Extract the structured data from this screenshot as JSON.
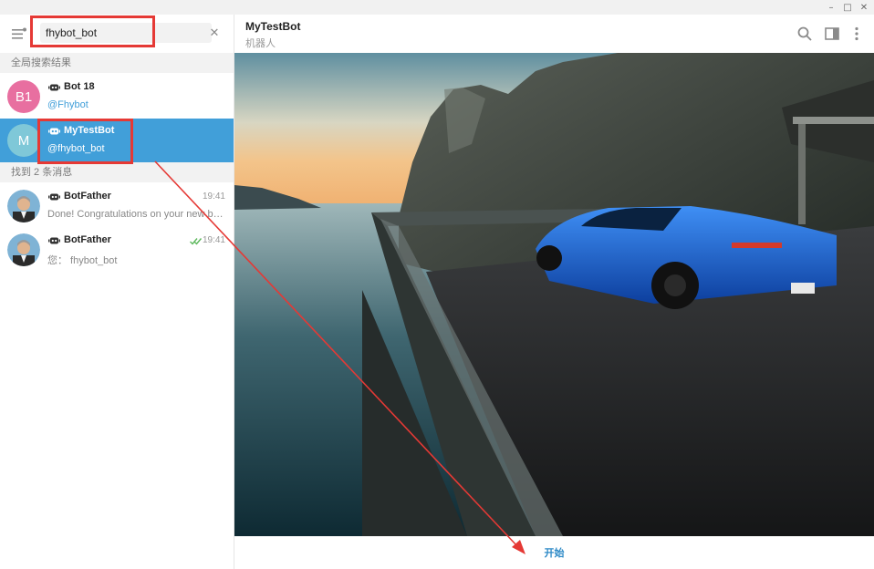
{
  "window": {
    "minimize_glyph": "–",
    "maximize_glyph": "□",
    "close_glyph": "✕"
  },
  "sidebar": {
    "menu_icon": "hamburger-menu-icon",
    "search": {
      "value": "fhybot_bot",
      "clear_glyph": "✕"
    },
    "global_section_label": "全局搜索结果",
    "global_results": [
      {
        "avatar_text": "B1",
        "avatar_color": "#e86fa0",
        "name": "Bot 18",
        "subtitle": "@Fhybot"
      },
      {
        "avatar_text": "M",
        "avatar_color": "#7fc8d8",
        "name": "MyTestBot",
        "subtitle": "@fhybot_bot",
        "selected": true
      }
    ],
    "messages_section_label": "找到 2 条消息",
    "message_results": [
      {
        "name": "BotFather",
        "time": "19:41",
        "snippet": "Done! Congratulations on your new bot. ..."
      },
      {
        "name": "BotFather",
        "time": "19:41",
        "snippet": "您：  fhybot_bot",
        "read": true
      }
    ]
  },
  "chat": {
    "title": "MyTestBot",
    "status": "机器人",
    "icons": [
      "search-icon",
      "sidebar-toggle-icon",
      "more-vertical-icon"
    ],
    "start_label": "开始"
  },
  "colors": {
    "accent": "#419fd9",
    "annotation": "#e53935",
    "start": "#2e8ac7"
  }
}
